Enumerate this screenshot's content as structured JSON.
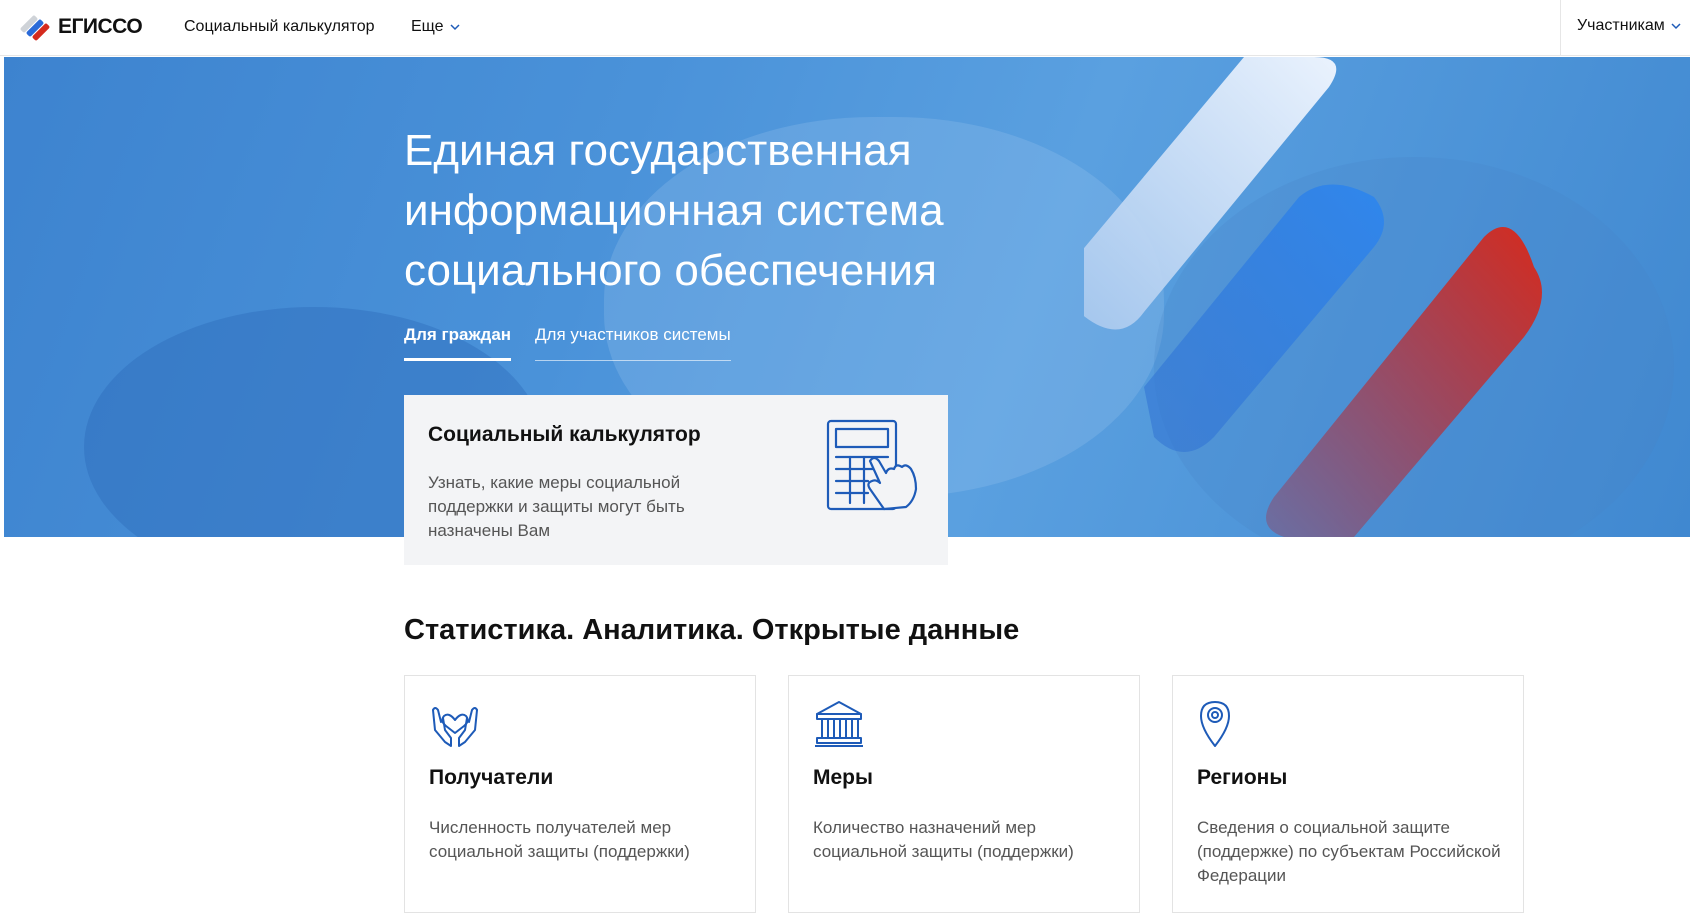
{
  "header": {
    "logo_text": "ЕГИССО",
    "nav": {
      "calculator": "Социальный калькулятор",
      "more": "Еще",
      "participants": "Участникам"
    }
  },
  "hero": {
    "title": "Единая государственная информационная система социального обеспечения",
    "tabs": [
      {
        "label": "Для граждан",
        "active": true
      },
      {
        "label": "Для участников системы",
        "active": false
      }
    ]
  },
  "calculator_card": {
    "title": "Социальный калькулятор",
    "description": "Узнать, какие меры социальной поддержки и защиты могут быть назначены Вам",
    "icon": "calculator-hand-icon"
  },
  "stats": {
    "title": "Статистика. Аналитика. Открытые данные",
    "cards": [
      {
        "icon": "hands-heart-icon",
        "title": "Получатели",
        "description": "Численность получателей мер социальной защиты (поддержки)"
      },
      {
        "icon": "government-building-icon",
        "title": "Меры",
        "description": "Количество назначений мер социальной защиты (поддержки)"
      },
      {
        "icon": "map-pin-icon",
        "title": "Регионы",
        "description": "Сведения о социальной защите (поддержке) по субъектам Российской Федерации"
      }
    ]
  },
  "colors": {
    "accent_blue": "#1e5bb8",
    "hero_blue": "#4a92d9",
    "flag_red": "#d52b1e",
    "card_bg": "#f3f4f6"
  }
}
